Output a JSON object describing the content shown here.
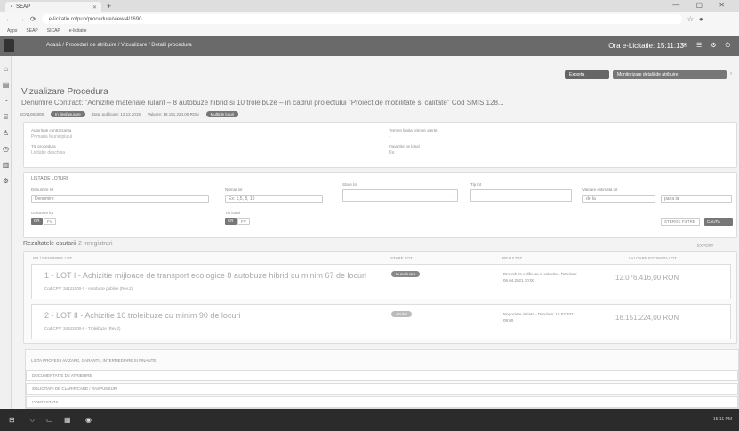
{
  "browser": {
    "tab_title": "SEAP",
    "url": "e-licitatie.ro/pub/procedure/view/4/1690",
    "bookmarks": [
      "Apps",
      "SEAP",
      "SICAP",
      "e-licitatie"
    ]
  },
  "header": {
    "crumb": "Acasă / Proceduri de atribuire / Vizualizare / Detalii procedura",
    "clock": "Ora e-Licitatie: 15:11:13"
  },
  "actions": {
    "export_label": "Exporta",
    "watch_label": "Monitorizare detalii de atribuire"
  },
  "page": {
    "title": "Vizualizare Procedura",
    "contract": "Denumire Contract: \"Achizitie materiale rulant – 8 autobuze hibrid si 10 troleibuze – in cadrul proiectului \"Proiect de mobilitate si calitate\" Cod SMIS 128...",
    "meta": [
      "SCN1082808",
      "Data publicare: 12.12.2019",
      "Valoare: 18.151.224,00 RON"
    ],
    "status_pill": "In desfasurare",
    "lots_pill": "Multiple loturi"
  },
  "info": {
    "authority_label": "Autoritate contractanta",
    "authority_value": "Primaria Municipiului",
    "type_label": "Tip procedura",
    "type_value": "Licitatie deschisa",
    "deadline_label": "Termen limita primire oferte",
    "deadline_value": "-",
    "division_label": "Impartire pe loturi",
    "division_value": "Da"
  },
  "filters": {
    "section_title": "Lista de loturi",
    "lot_name_label": "Denumire lot",
    "lot_name_value": "Denumire",
    "lot_number_label": "Numar lot",
    "lot_number_value": "Ex: 1,5, 8, 10",
    "status_label": "Stare lot",
    "type_label": "Tip lot",
    "value_label": "Valoare estimata lot",
    "value_from": "de la",
    "value_to": "pana la",
    "order_label": "Ordonare lot",
    "order_options": [
      "CR",
      "FV"
    ],
    "cat_label": "Tip loturi",
    "cat_options": [
      "CR",
      "FV"
    ],
    "clear_label": "Sterge filtre",
    "search_label": "Cauta"
  },
  "results": {
    "title": "Rezultatele cautarii",
    "count_label": "2 inregistrari",
    "cols": [
      "Nr / Denumire lot",
      "Stare lot",
      "Rezultat",
      "Valoare estimata lot"
    ],
    "export_small": "Export",
    "lots": [
      {
        "title": "1 - LOT I - Achizitie mijloace de transport ecologice 8 autobuze hibrid cu minim 67 de locuri",
        "cpv": "Cod CPV: 34121000-1 - Autobuze publice (Rev.2)",
        "badge": "In evaluare",
        "status": "Procedura calificare si selectie - Derulare: 06.04.2021 10:00",
        "value": "12.076.416,00 RON"
      },
      {
        "title": "2 - LOT II - Achizitie 10 troleibuze cu minim 90 de locuri",
        "cpv": "Cod CPV: 34622000-6 - Troleibuze (Rev.2)",
        "badge": "Anulat",
        "status": "Negociere initiata - Derulare: 16.02.2021 09:00",
        "value": "18.151.224,00 RON"
      }
    ]
  },
  "accordion": [
    "Lista profesii Avizare, Garantii, Intermediare si finante",
    "Documentatie de atribuire",
    "Solicitari de clarificare / raspunsuri",
    "Contestatii"
  ],
  "taskbar": {
    "tray_text": "15:11 PM"
  }
}
